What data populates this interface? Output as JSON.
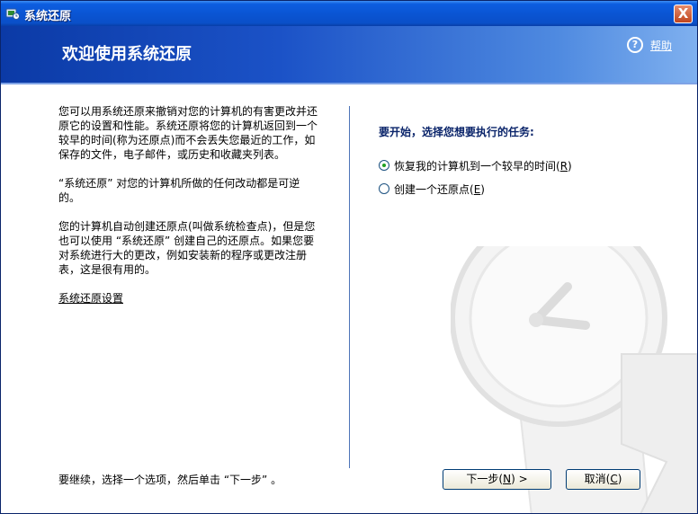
{
  "window": {
    "title": "系统还原",
    "close_label": "X"
  },
  "header": {
    "title": "欢迎使用系统还原",
    "help_label": "帮助"
  },
  "left": {
    "paragraphs": [
      "您可以用系统还原来撤销对您的计算机的有害更改并还原它的设置和性能。系统还原将您的计算机返回到一个较早的时间(称为还原点)而不会丢失您最近的工作，如保存的文件，电子邮件，或历史和收藏夹列表。",
      "“系统还原” 对您的计算机所做的任何改动都是可逆的。",
      "您的计算机自动创建还原点(叫做系统检查点)，但是您也可以使用 “系统还原” 创建自己的还原点。如果您要对系统进行大的更改，例如安装新的程序或更改注册表，这是很有用的。"
    ],
    "settings_link": "系统还原设置"
  },
  "right": {
    "heading": "要开始，选择您想要执行的任务:",
    "options": [
      {
        "label": "恢复我的计算机到一个较早的时间",
        "key": "R",
        "selected": true
      },
      {
        "label": "创建一个还原点",
        "key": "E",
        "selected": false
      }
    ]
  },
  "footer": {
    "instruction": "要继续，选择一个选项，然后单击 “下一步” 。",
    "next_label": "下一步",
    "next_key": "N",
    "next_suffix": " >",
    "cancel_label": "取消",
    "cancel_key": "C"
  },
  "icons": {
    "app": "system-restore-icon",
    "help": "help-icon",
    "close": "close-icon",
    "watermark": "clock-arrow-icon"
  }
}
